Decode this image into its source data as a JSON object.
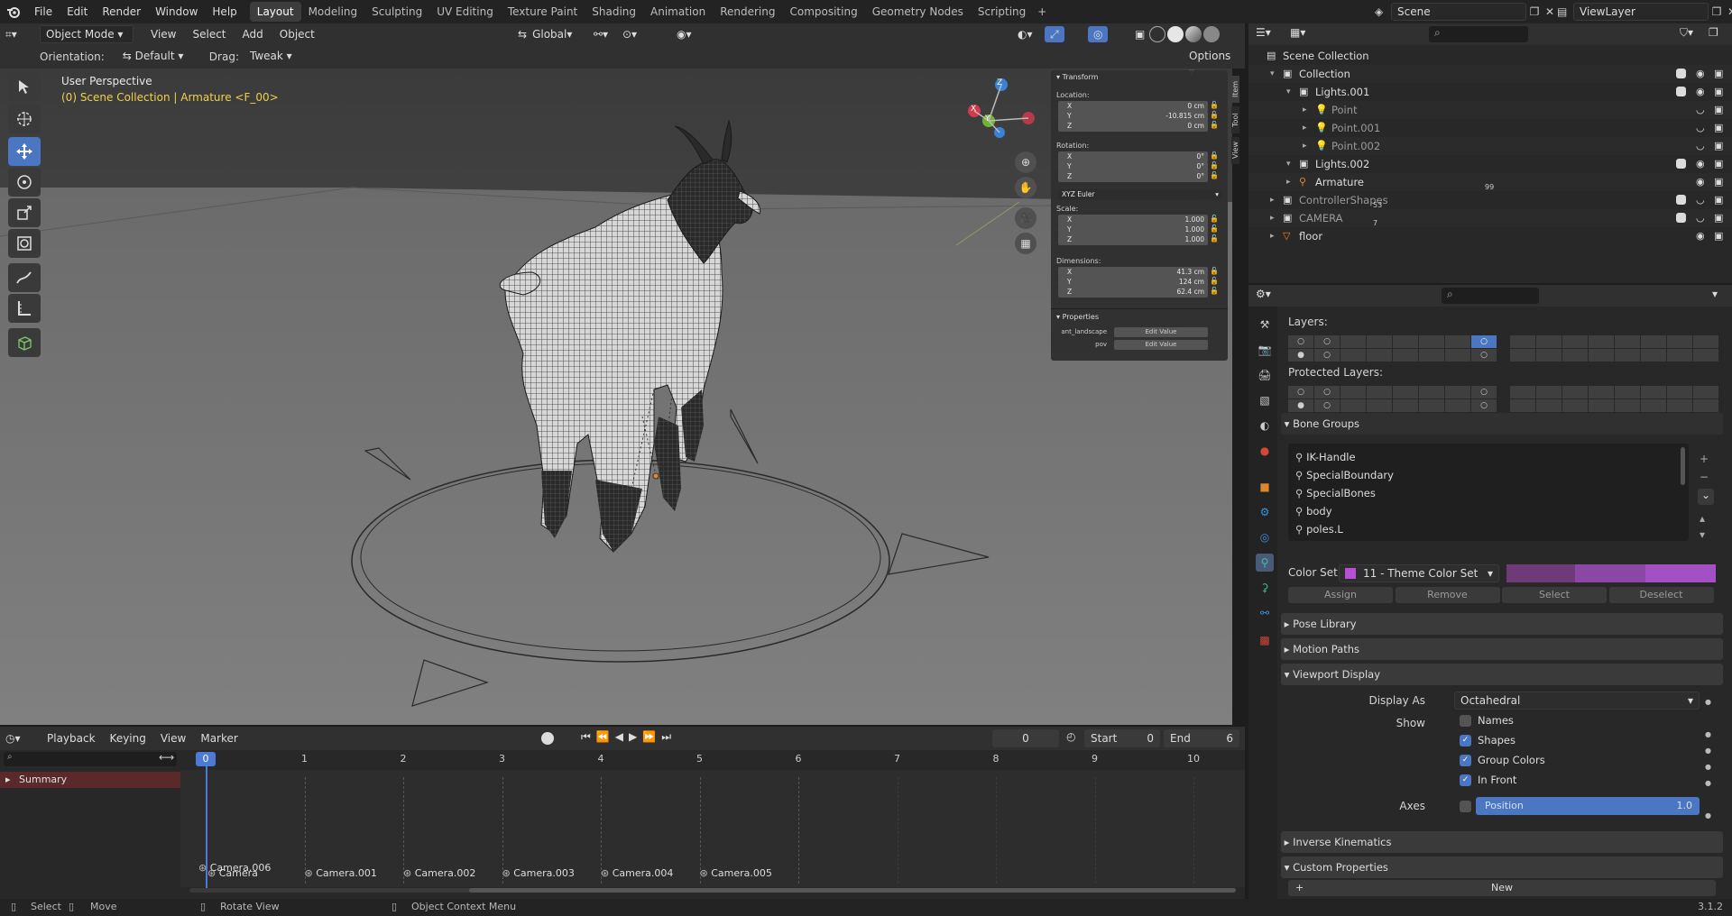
{
  "top_menu": {
    "items": [
      "File",
      "Edit",
      "Render",
      "Window",
      "Help"
    ],
    "workspaces": [
      "Layout",
      "Modeling",
      "Sculpting",
      "UV Editing",
      "Texture Paint",
      "Shading",
      "Animation",
      "Rendering",
      "Compositing",
      "Geometry Nodes",
      "Scripting"
    ],
    "active_workspace": "Layout",
    "scene_label": "Scene",
    "viewlayer_label": "ViewLayer"
  },
  "viewport": {
    "mode": "Object Mode",
    "menus": [
      "View",
      "Select",
      "Add",
      "Object"
    ],
    "transform_orientation": "Global",
    "orientation_label": "Orientation:",
    "orientation_value": "Default",
    "drag_label": "Drag:",
    "drag_value": "Tweak",
    "options_label": "Options",
    "overlay_title": "User Perspective",
    "overlay_context": "(0) Scene Collection | Armature <F_00>",
    "gizmo": {
      "x": "X",
      "y": "Y",
      "z": "Z"
    }
  },
  "npanel": {
    "tabs": [
      "Item",
      "Tool",
      "View"
    ],
    "transform_title": "Transform",
    "location_label": "Location:",
    "location": [
      {
        "k": "X",
        "v": "0 cm"
      },
      {
        "k": "Y",
        "v": "-10.815 cm"
      },
      {
        "k": "Z",
        "v": "0 cm"
      }
    ],
    "rotation_label": "Rotation:",
    "rotation": [
      {
        "k": "X",
        "v": "0°"
      },
      {
        "k": "Y",
        "v": "0°"
      },
      {
        "k": "Z",
        "v": "0°"
      }
    ],
    "rotation_mode": "XYZ Euler",
    "scale_label": "Scale:",
    "scale": [
      {
        "k": "X",
        "v": "1.000"
      },
      {
        "k": "Y",
        "v": "1.000"
      },
      {
        "k": "Z",
        "v": "1.000"
      }
    ],
    "dimensions_label": "Dimensions:",
    "dimensions": [
      {
        "k": "X",
        "v": "41.3 cm"
      },
      {
        "k": "Y",
        "v": "124 cm"
      },
      {
        "k": "Z",
        "v": "62.4 cm"
      }
    ],
    "properties_title": "Properties",
    "custom_props": [
      {
        "name": "ant_landscape",
        "btn": "Edit Value"
      },
      {
        "name": "pov",
        "btn": "Edit Value"
      }
    ]
  },
  "timeline": {
    "menus": [
      "Playback",
      "Keying",
      "View",
      "Marker"
    ],
    "current_frame": "0",
    "start_label": "Start",
    "start": "0",
    "end_label": "End",
    "end": "6",
    "frame_ticks": [
      "0",
      "1",
      "2",
      "3",
      "4",
      "5",
      "6",
      "7",
      "8",
      "9",
      "10"
    ],
    "summary_label": "Summary",
    "markers": [
      "Camera.006",
      "Camera",
      "Camera.001",
      "Camera.002",
      "Camera.003",
      "Camera.004",
      "Camera.005"
    ]
  },
  "status_bar": {
    "items": [
      "Select",
      "Move",
      "Rotate View",
      "Object Context Menu"
    ],
    "version": "3.1.2"
  },
  "outliner": {
    "rows": [
      {
        "label": "Scene Collection",
        "depth": 0,
        "kind": "scene"
      },
      {
        "label": "Collection",
        "depth": 1,
        "kind": "collection"
      },
      {
        "label": "Lights.001",
        "depth": 2,
        "kind": "collection"
      },
      {
        "label": "Point",
        "depth": 3,
        "kind": "light",
        "dim": true
      },
      {
        "label": "Point.001",
        "depth": 3,
        "kind": "light",
        "dim": true
      },
      {
        "label": "Point.002",
        "depth": 3,
        "kind": "light",
        "dim": true
      },
      {
        "label": "Lights.002",
        "depth": 2,
        "kind": "collection"
      },
      {
        "label": "Armature",
        "depth": 2,
        "kind": "armature",
        "badge": "99"
      },
      {
        "label": "ControllerShapes",
        "depth": 1,
        "kind": "collection",
        "dim": true,
        "badge": "53"
      },
      {
        "label": "CAMERA",
        "depth": 1,
        "kind": "collection",
        "dim": true,
        "badge": "7"
      },
      {
        "label": "floor",
        "depth": 1,
        "kind": "mesh"
      }
    ]
  },
  "properties": {
    "layers_label": "Layers:",
    "protected_layers_label": "Protected Layers:",
    "bone_groups_label": "Bone Groups",
    "bone_groups": [
      "IK-Handle",
      "SpecialBoundary",
      "SpecialBones",
      "body",
      "poles.L"
    ],
    "color_set_label": "Color Set:",
    "color_set_value": "11 - Theme Color Set",
    "buttons": [
      "Assign",
      "Remove",
      "Select",
      "Deselect"
    ],
    "pose_library_label": "Pose Library",
    "motion_paths_label": "Motion Paths",
    "viewport_display_label": "Viewport Display",
    "display_as_label": "Display As",
    "display_as_value": "Octahedral",
    "show_label": "Show",
    "show_options": [
      {
        "label": "Names",
        "checked": false
      },
      {
        "label": "Shapes",
        "checked": true
      },
      {
        "label": "Group Colors",
        "checked": true
      },
      {
        "label": "In Front",
        "checked": true
      }
    ],
    "axes_label": "Axes",
    "axes_position_label": "Position",
    "axes_position_value": "1.0",
    "inverse_kinematics_label": "Inverse Kinematics",
    "custom_properties_label": "Custom Properties",
    "new_label": "New"
  },
  "colors": {
    "accent": "#4a76c2",
    "active_frame": "#4d7ad6",
    "header": "#303030",
    "panel": "#282828"
  }
}
